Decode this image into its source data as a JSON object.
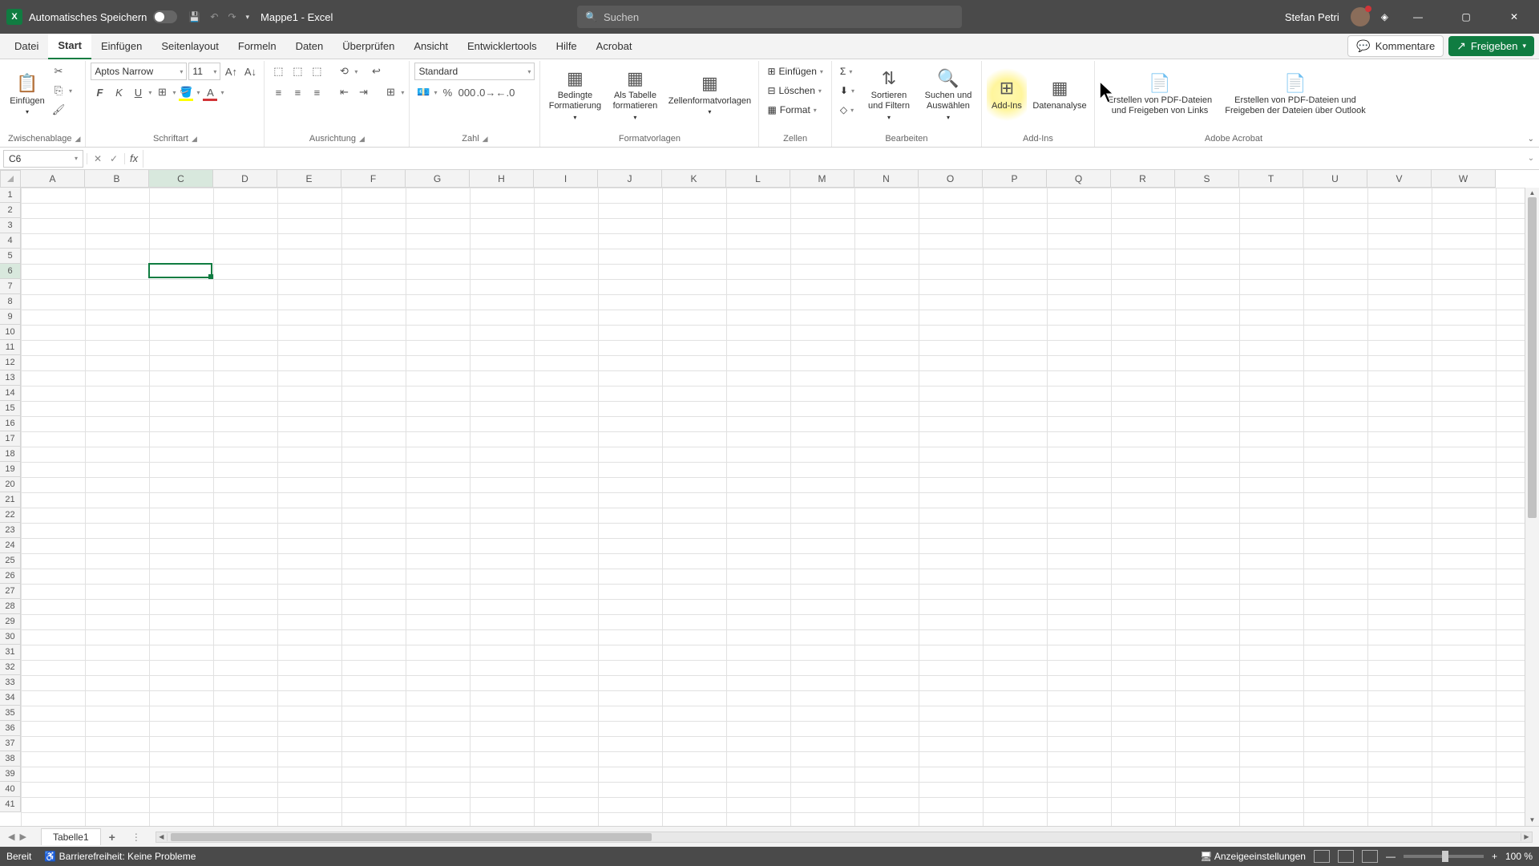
{
  "titlebar": {
    "autosave_label": "Automatisches Speichern",
    "doc_name": "Mappe1",
    "app_name": "Excel",
    "doc_sep": " - ",
    "search_placeholder": "Suchen",
    "user_name": "Stefan Petri"
  },
  "tabs": {
    "items": [
      "Datei",
      "Start",
      "Einfügen",
      "Seitenlayout",
      "Formeln",
      "Daten",
      "Überprüfen",
      "Ansicht",
      "Entwicklertools",
      "Hilfe",
      "Acrobat"
    ],
    "active": "Start",
    "comments_label": "Kommentare",
    "share_label": "Freigeben"
  },
  "ribbon": {
    "clipboard": {
      "paste_label": "Einfügen",
      "group_label": "Zwischenablage"
    },
    "font": {
      "font_name": "Aptos Narrow",
      "font_size": "11",
      "bold": "F",
      "italic": "K",
      "underline": "U",
      "group_label": "Schriftart"
    },
    "alignment": {
      "group_label": "Ausrichtung"
    },
    "number": {
      "format_value": "Standard",
      "group_label": "Zahl"
    },
    "styles": {
      "cond_format": "Bedingte Formatierung",
      "as_table": "Als Tabelle formatieren",
      "cell_styles": "Zellenformatvorlagen",
      "group_label": "Formatvorlagen"
    },
    "cells": {
      "insert": "Einfügen",
      "delete": "Löschen",
      "format": "Format",
      "group_label": "Zellen"
    },
    "editing": {
      "sort_filter": "Sortieren und Filtern",
      "find_select": "Suchen und Auswählen",
      "group_label": "Bearbeiten"
    },
    "addins": {
      "addins": "Add-Ins",
      "data_analysis": "Datenanalyse",
      "group_label": "Add-Ins"
    },
    "acrobat": {
      "pdf_links": "Erstellen von PDF-Dateien und Freigeben von Links",
      "pdf_outlook": "Erstellen von PDF-Dateien und Freigeben der Dateien über Outlook",
      "group_label": "Adobe Acrobat"
    }
  },
  "formula_bar": {
    "name_box": "C6",
    "formula": ""
  },
  "grid": {
    "columns": [
      "A",
      "B",
      "C",
      "D",
      "E",
      "F",
      "G",
      "H",
      "I",
      "J",
      "K",
      "L",
      "M",
      "N",
      "O",
      "P",
      "Q",
      "R",
      "S",
      "T",
      "U",
      "V",
      "W"
    ],
    "rows": 41,
    "active_col_index": 2,
    "active_row_index": 5
  },
  "sheets": {
    "active_name": "Tabelle1"
  },
  "statusbar": {
    "ready": "Bereit",
    "accessibility": "Barrierefreiheit: Keine Probleme",
    "display_settings": "Anzeigeeinstellungen",
    "zoom": "100 %"
  }
}
